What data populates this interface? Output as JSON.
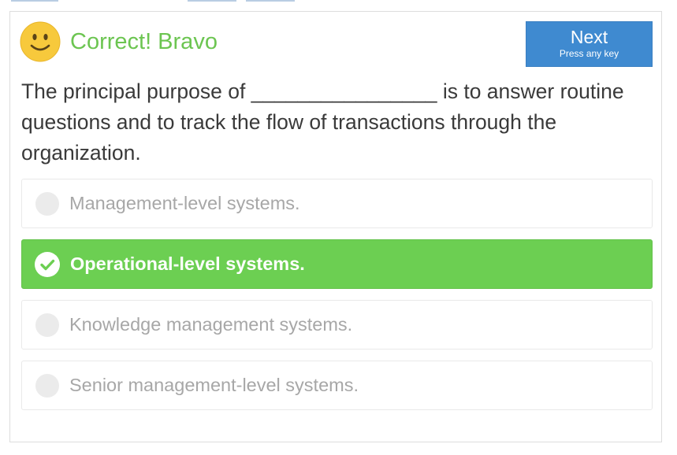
{
  "feedback": {
    "text": "Correct! Bravo",
    "icon": "smiley-icon",
    "color": "#6cc551"
  },
  "next_button": {
    "label": "Next",
    "hint": "Press any key",
    "color": "#3f8ad0"
  },
  "question": {
    "text": "The principal purpose of ________________ is to answer routine questions and to track the flow of transactions through the organization."
  },
  "options": [
    {
      "label": "Management-level systems.",
      "state": "unselected"
    },
    {
      "label": "Operational-level systems.",
      "state": "correct"
    },
    {
      "label": "Knowledge management systems.",
      "state": "unselected"
    },
    {
      "label": "Senior management-level systems.",
      "state": "unselected"
    }
  ],
  "colors": {
    "correct_option": "#6ccf52",
    "question_text": "#3a3a3a",
    "option_text": "#a7a7a7"
  }
}
